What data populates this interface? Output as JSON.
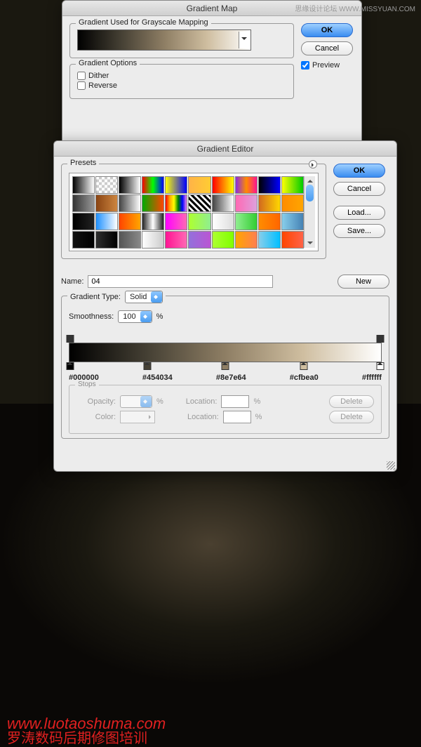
{
  "watermarks": {
    "top_right": "思缘设计论坛 WWW.MISSYUAN.COM",
    "url": "www.luotaoshuma.com",
    "cn": "罗涛数码后期修图培训"
  },
  "gradient_map": {
    "title": "Gradient Map",
    "section_mapping": "Gradient Used for Grayscale Mapping",
    "section_options": "Gradient Options",
    "dither": "Dither",
    "reverse": "Reverse",
    "ok": "OK",
    "cancel": "Cancel",
    "preview": "Preview"
  },
  "gradient_editor": {
    "title": "Gradient Editor",
    "presets_label": "Presets",
    "ok": "OK",
    "cancel": "Cancel",
    "load": "Load...",
    "save": "Save...",
    "name_label": "Name:",
    "name_value": "04",
    "new_btn": "New",
    "type_label": "Gradient Type:",
    "type_value": "Solid",
    "smoothness_label": "Smoothness:",
    "smoothness_value": "100",
    "percent": "%",
    "color_stops": [
      "#000000",
      "#454034",
      "#8e7e64",
      "#cfbea0",
      "#ffffff"
    ],
    "stops_label": "Stops",
    "opacity_label": "Opacity:",
    "color_label": "Color:",
    "location_label": "Location:",
    "delete": "Delete"
  },
  "presets": [
    "linear-gradient(90deg,#000,#fff)",
    "repeating-conic-gradient(#ccc 0 25%, #fff 0 50%) 0/8px 8px",
    "linear-gradient(90deg,#000,#fff)",
    "linear-gradient(90deg,#f00,#0f0,#00f)",
    "linear-gradient(90deg,#ff0,#00f)",
    "linear-gradient(90deg,#ffb347,#ffcc33)",
    "linear-gradient(90deg,#f00,#ff0)",
    "linear-gradient(90deg,#8a2be2,#ff8c00,#ff1493)",
    "linear-gradient(90deg,#000,#00f)",
    "linear-gradient(90deg,#ff0,#0c0)",
    "linear-gradient(90deg,#333,#999)",
    "linear-gradient(90deg,#8b4513,#cd853f)",
    "linear-gradient(90deg,#444,#fff)",
    "linear-gradient(90deg,#0a0,#ff4500)",
    "linear-gradient(90deg,red,orange,yellow,green,blue,violet)",
    "repeating-linear-gradient(45deg,#000 0 3px,#fff 3px 6px)",
    "linear-gradient(90deg,#444,#fff)",
    "linear-gradient(90deg,#ff69b4,#dda0dd)",
    "linear-gradient(90deg,#d2691e,#ffd700)",
    "linear-gradient(90deg,#ff8c00,#ffa500)",
    "linear-gradient(90deg,#000,#222)",
    "linear-gradient(90deg,#1e90ff,#fff)",
    "linear-gradient(90deg,#ff4500,#ffa500)",
    "linear-gradient(90deg,#222,#fff,#222)",
    "linear-gradient(90deg,#ff00ff,#ff69b4)",
    "linear-gradient(90deg,#adff2f,#90ee90)",
    "linear-gradient(90deg,#fff,#ddd)",
    "linear-gradient(90deg,#90ee90,#32cd32)",
    "linear-gradient(90deg,#ff8c00,#ff6600)",
    "linear-gradient(90deg,#87ceeb,#4682b4)",
    "linear-gradient(90deg,#111,#000)",
    "linear-gradient(90deg,#2e2e2e,#000)",
    "linear-gradient(90deg,#555,#888)",
    "linear-gradient(90deg,#fff,#ccc)",
    "linear-gradient(90deg,#ff1493,#ff69b4)",
    "linear-gradient(90deg,#9370db,#ba55d3)",
    "linear-gradient(90deg,#adff2f,#7fff00)",
    "linear-gradient(90deg,#ffa500,#ff7f50)",
    "linear-gradient(90deg,#87ceeb,#00bfff)",
    "linear-gradient(90deg,#ff4500,#ff6347)"
  ]
}
